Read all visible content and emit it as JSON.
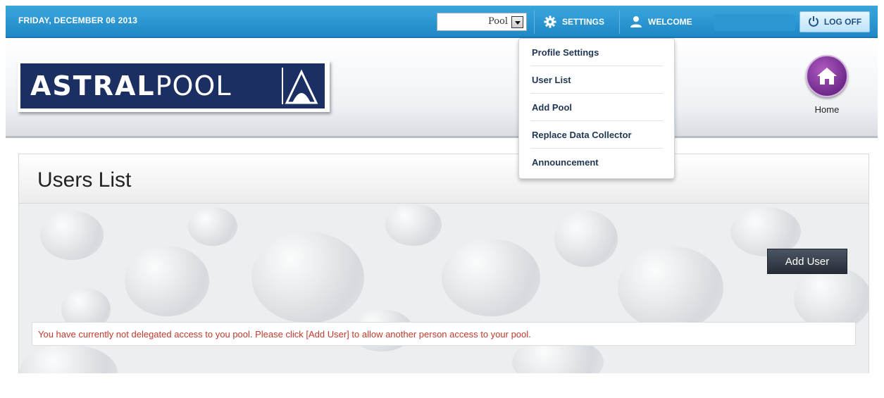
{
  "topbar": {
    "date": "FRIDAY, DECEMBER 06 2013",
    "pool_select_value": "Pool",
    "settings_label": "SETTINGS",
    "welcome_label": "WELCOME",
    "logoff_label": "LOG OFF"
  },
  "header": {
    "logo_bold": "ASTRAL",
    "logo_light": "POOL",
    "home_label": "Home"
  },
  "settings_menu": {
    "items": [
      {
        "label": "Profile Settings"
      },
      {
        "label": "User List"
      },
      {
        "label": "Add Pool"
      },
      {
        "label": "Replace Data Collector"
      },
      {
        "label": "Announcement"
      }
    ]
  },
  "main": {
    "title": "Users List",
    "add_user_label": "Add User",
    "message": "You have currently not delegated access to you pool. Please click [Add User] to allow another person access to your pool."
  },
  "colors": {
    "topbar": "#2b97d3",
    "logo_bg": "#1c2f62",
    "message_text": "#c0392b",
    "home_button": "#8a3aa0"
  }
}
